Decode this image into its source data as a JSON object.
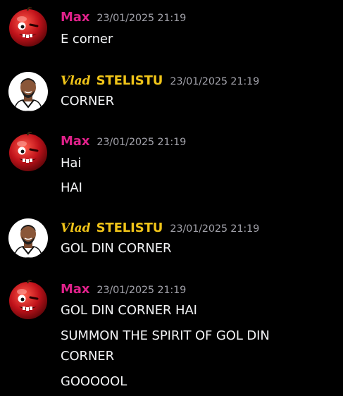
{
  "users": {
    "max": {
      "name": "Max",
      "color": "#e0218a",
      "avatar": "apple-face-avatar"
    },
    "vlad": {
      "tag": "Vlad",
      "name": "STELISTU",
      "color": "#f0c419",
      "avatar": "player-avatar"
    }
  },
  "messages": [
    {
      "author": "Max",
      "timestamp": "23/01/2025 21:19",
      "lines": [
        "E corner"
      ]
    },
    {
      "author_tag": "Vlad",
      "author": "STELISTU",
      "timestamp": "23/01/2025 21:19",
      "lines": [
        "CORNER"
      ]
    },
    {
      "author": "Max",
      "timestamp": "23/01/2025 21:19",
      "lines": [
        "Hai",
        "HAI"
      ]
    },
    {
      "author_tag": "Vlad",
      "author": "STELISTU",
      "timestamp": "23/01/2025 21:19",
      "lines": [
        "GOL DIN CORNER"
      ]
    },
    {
      "author": "Max",
      "timestamp": "23/01/2025 21:19",
      "lines": [
        "GOL DIN CORNER HAI",
        "SUMMON THE SPIRIT OF GOL DIN",
        "CORNER",
        "GOOOOOL"
      ]
    }
  ]
}
